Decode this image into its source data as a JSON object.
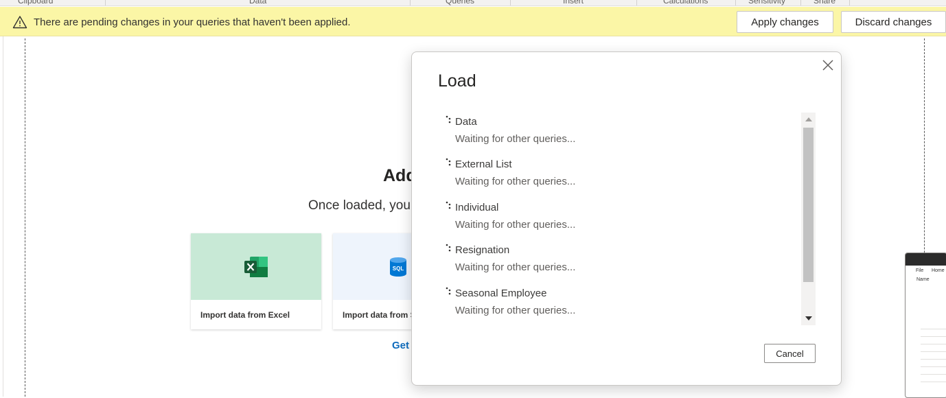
{
  "ribbon": {
    "groups": [
      "Clipboard",
      "Data",
      "Queries",
      "Insert",
      "Calculations",
      "Sensitivity",
      "Share"
    ]
  },
  "banner": {
    "message": "There are pending changes in your queries that haven't been applied.",
    "apply_label": "Apply changes",
    "discard_label": "Discard changes",
    "icon": "warning-icon",
    "color": "#fbf6a6"
  },
  "canvas": {
    "title": "Add",
    "subtitle": "Once loaded, you",
    "cards": [
      {
        "label": "Import data from Excel",
        "icon": "excel-icon",
        "color": "#c8e9d6"
      },
      {
        "label": "Import data from S",
        "icon": "sql-icon",
        "color": "#eef4fc"
      }
    ],
    "get_link": "Get"
  },
  "dialog": {
    "title": "Load",
    "items": [
      {
        "name": "Data",
        "status": "Waiting for other queries..."
      },
      {
        "name": "External List",
        "status": "Waiting for other queries..."
      },
      {
        "name": "Individual",
        "status": "Waiting for other queries..."
      },
      {
        "name": "Resignation",
        "status": "Waiting for other queries..."
      },
      {
        "name": "Seasonal Employee",
        "status": "Waiting for other queries..."
      }
    ],
    "cancel_label": "Cancel"
  },
  "thumbnail": {
    "menu": [
      "File",
      "Home"
    ],
    "name_label": "Name"
  }
}
